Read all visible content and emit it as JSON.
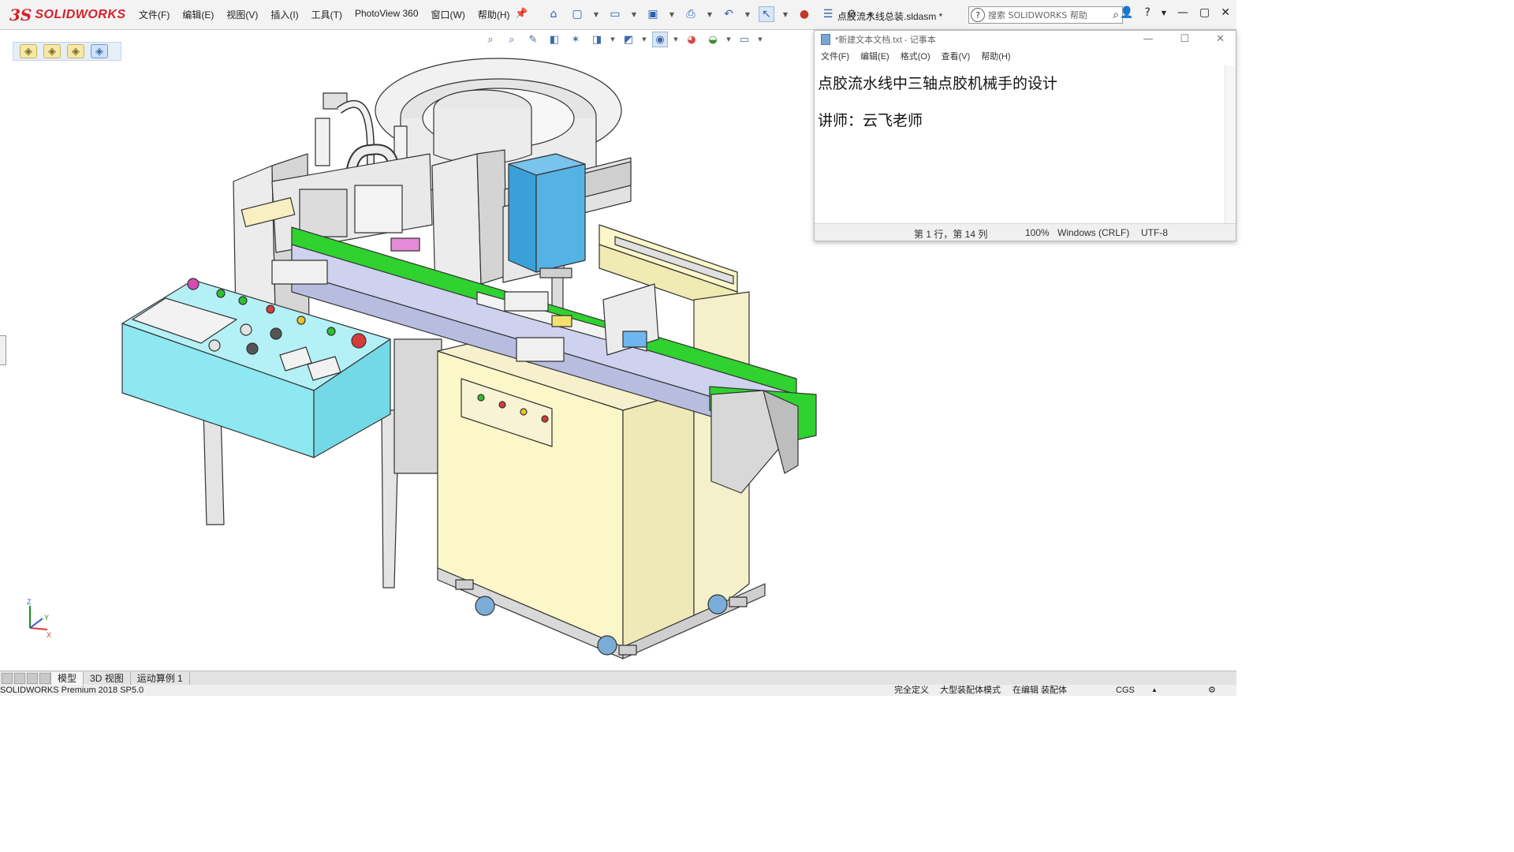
{
  "app": {
    "logo_ds": "3S",
    "logo_text": "SOLIDWORKS",
    "document_title": "点胶流水线总装.sldasm *"
  },
  "menu": {
    "items": [
      "文件(F)",
      "编辑(E)",
      "视图(V)",
      "插入(I)",
      "工具(T)",
      "PhotoView 360",
      "窗口(W)",
      "帮助(H)"
    ]
  },
  "search": {
    "placeholder": "搜索 SOLIDWORKS 帮助"
  },
  "toolbar_icons": [
    "home-icon",
    "new-icon",
    "open-icon",
    "save-icon",
    "print-icon",
    "undo-icon",
    "select-icon",
    "rebuild-icon",
    "file-properties-icon",
    "options-icon"
  ],
  "heads_up_icons": [
    "zoom-to-fit-icon",
    "zoom-area-icon",
    "previous-view-icon",
    "section-view-icon",
    "dynamic-annotation-icon",
    "view-orientation-icon",
    "display-style-icon",
    "hide-show-icon",
    "edit-appearance-icon",
    "apply-scene-icon",
    "view-settings-icon"
  ],
  "notepad": {
    "title": "*新建文本文档.txt - 记事本",
    "menu": [
      "文件(F)",
      "编辑(E)",
      "格式(O)",
      "查看(V)",
      "帮助(H)"
    ],
    "line1": "点胶流水线中三轴点胶机械手的设计",
    "line2": "讲师：云飞老师",
    "status": {
      "position": "第 1 行，第 14 列",
      "zoom": "100%",
      "line_ending": "Windows (CRLF)",
      "encoding": "UTF-8"
    }
  },
  "bottom_tabs": [
    "模型",
    "3D 视图",
    "运动算例 1"
  ],
  "status_bar": {
    "version": "SOLIDWORKS Premium 2018 SP5.0",
    "definition": "完全定义",
    "large_assembly": "大型装配体模式",
    "editing": "在编辑 装配体",
    "units": "CGS"
  },
  "triad": {
    "z": "Z",
    "x": "X",
    "y": "Y"
  },
  "colors": {
    "brand": "#d8202b",
    "control_panel": "#8ee8f2",
    "conveyor_belt": "#2fd22f",
    "cabinet": "#fbf7c8",
    "dispenser_head": "#3aa0d8"
  }
}
